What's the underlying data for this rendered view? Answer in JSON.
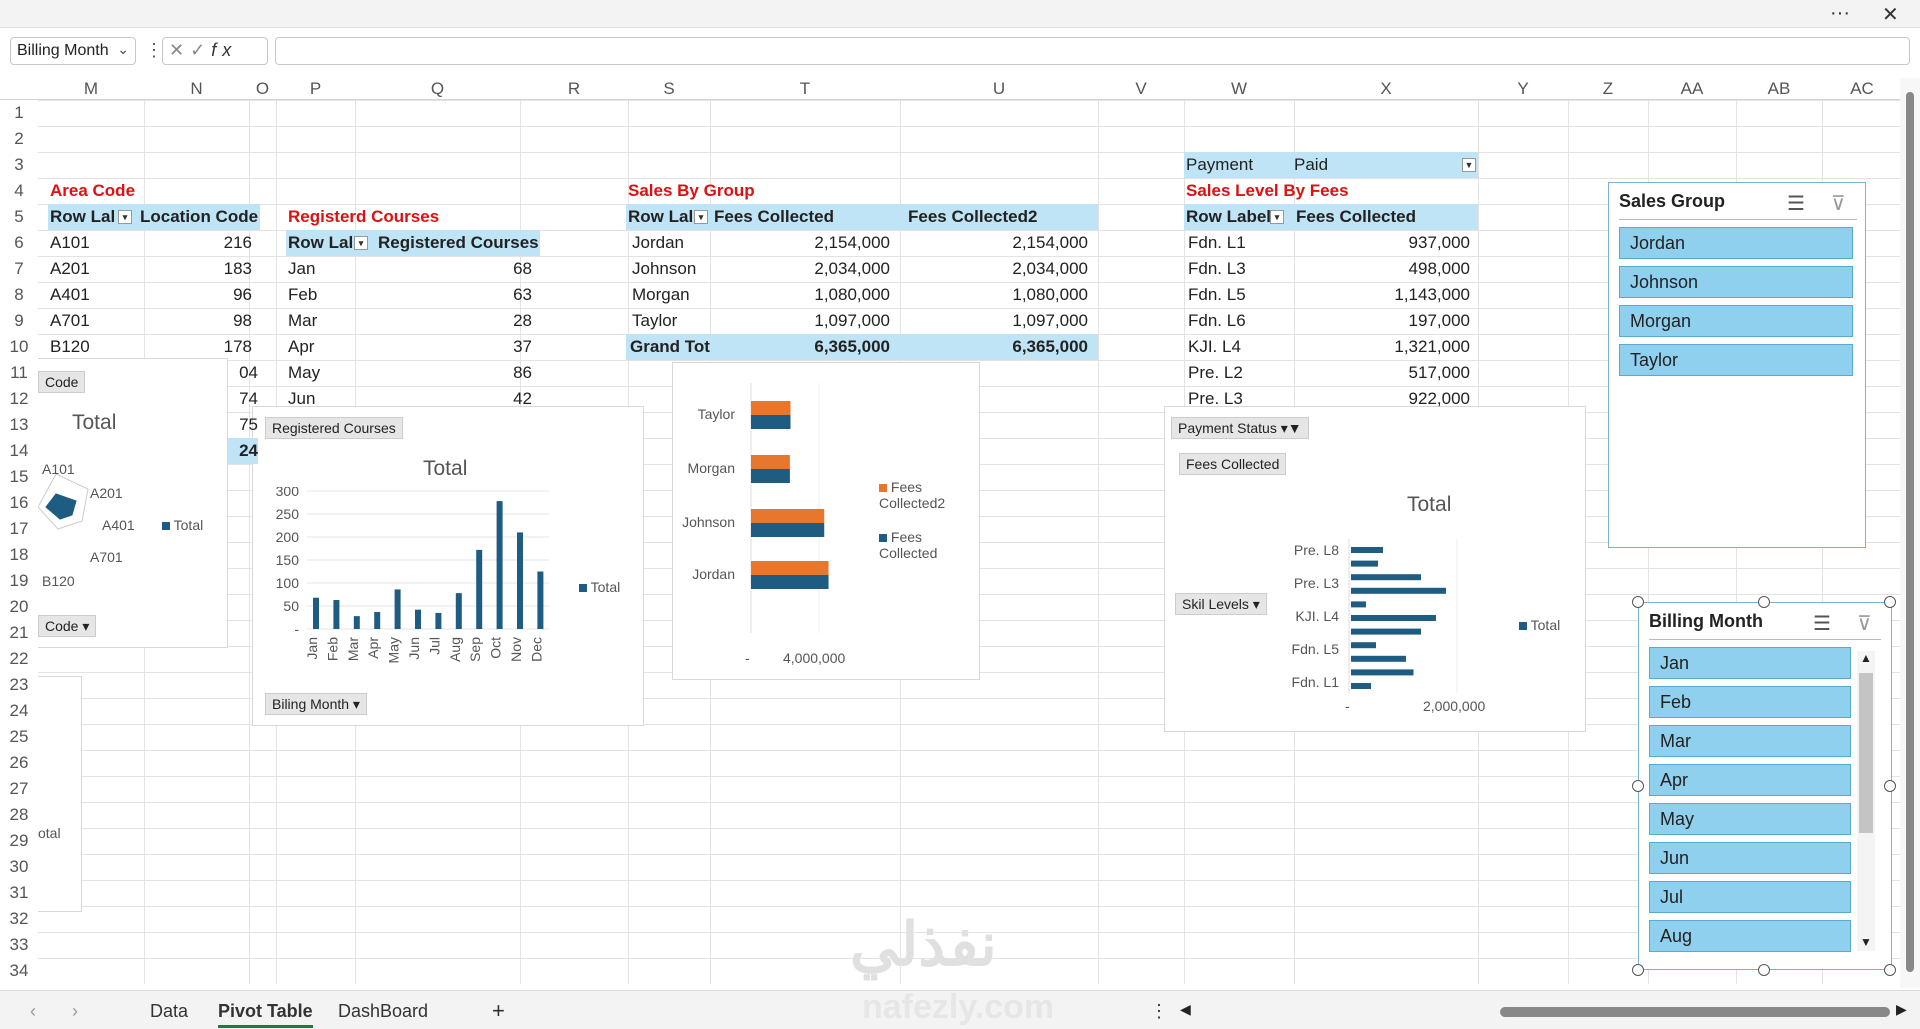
{
  "namebox": {
    "value": "Billing Month",
    "chevron": "⌄"
  },
  "formula_buttons": [
    "✕",
    "✓",
    "fx"
  ],
  "window_icons": {
    "more": "···",
    "close": "✕"
  },
  "columns": [
    "M",
    "N",
    "O",
    "P",
    "Q",
    "R",
    "S",
    "T",
    "U",
    "V",
    "W",
    "X",
    "Y",
    "Z",
    "AA",
    "AB",
    "AC"
  ],
  "rows": [
    "1",
    "2",
    "3",
    "4",
    "5",
    "6",
    "7",
    "8",
    "9",
    "10",
    "11",
    "12",
    "13",
    "14",
    "15",
    "16",
    "17",
    "18",
    "19",
    "20",
    "21",
    "22",
    "23",
    "24",
    "25",
    "26",
    "27",
    "28",
    "29",
    "30",
    "31",
    "32",
    "33",
    "34"
  ],
  "area_pivot": {
    "title": "Area Code",
    "headers": [
      "Row Lal",
      "Location Code"
    ],
    "rows": [
      [
        "A101",
        "216"
      ],
      [
        "A201",
        "183"
      ],
      [
        "A401",
        "96"
      ],
      [
        "A701",
        "98"
      ],
      [
        "B120",
        "178"
      ]
    ],
    "partial_values": [
      "04",
      "74",
      "75",
      "24"
    ]
  },
  "courses_pivot": {
    "title": "Registerd Courses",
    "headers": [
      "Row Lal",
      "Registered Courses"
    ],
    "rows": [
      [
        "Jan",
        "68"
      ],
      [
        "Feb",
        "63"
      ],
      [
        "Mar",
        "28"
      ],
      [
        "Apr",
        "37"
      ],
      [
        "May",
        "86"
      ],
      [
        "Jun",
        "42"
      ]
    ]
  },
  "group_pivot": {
    "title": "Sales By Group",
    "headers": [
      "Row Lal",
      "Fees Collected",
      "Fees Collected2"
    ],
    "rows": [
      [
        "Jordan",
        "2,154,000",
        "2,154,000"
      ],
      [
        "Johnson",
        "2,034,000",
        "2,034,000"
      ],
      [
        "Morgan",
        "1,080,000",
        "1,080,000"
      ],
      [
        "Taylor",
        "1,097,000",
        "1,097,000"
      ]
    ],
    "total": [
      "Grand Tot",
      "6,365,000",
      "6,365,000"
    ]
  },
  "level_pivot": {
    "filter_label": "Payment Sta",
    "filter_value": "Paid",
    "title": "Sales Level By Fees",
    "headers": [
      "Row Label",
      "Fees Collected"
    ],
    "rows": [
      [
        "Fdn. L1",
        "937,000"
      ],
      [
        "Fdn. L3",
        "498,000"
      ],
      [
        "Fdn. L5",
        "1,143,000"
      ],
      [
        "Fdn. L6",
        "197,000"
      ],
      [
        "KJI. L4",
        "1,321,000"
      ],
      [
        "Pre. L2",
        "517,000"
      ],
      [
        "Pre. L3",
        "922,000"
      ]
    ]
  },
  "radar_chart": {
    "field_button_top": "Code",
    "field_button_bottom": "Code",
    "title": "Total",
    "legend": "Total",
    "labels": [
      "A101",
      "A201",
      "A401",
      "A701",
      "B120"
    ]
  },
  "small_chart_stub": {
    "label": "otal"
  },
  "courses_chart": {
    "field_button_top": "Registered Courses",
    "field_button_bottom": "Biling  Month",
    "legend": "Total"
  },
  "group_chart": {
    "legend": [
      "Fees Collected2",
      "Fees Collected"
    ],
    "axis_ticks": [
      "-",
      "4,000,000"
    ]
  },
  "level_chart": {
    "field_button_filter": "Payment Status",
    "field_button_value": "Fees Collected",
    "field_button_axis": "Skil  Levels",
    "title": "Total",
    "legend": "Total",
    "axis_ticks": [
      "-",
      "2,000,000"
    ]
  },
  "chart_data": [
    {
      "type": "radar",
      "title": "Total",
      "categories": [
        "A101",
        "A201",
        "A401",
        "A701",
        "B120"
      ],
      "values": [
        216,
        183,
        96,
        98,
        178
      ],
      "series": [
        {
          "name": "Total",
          "values": [
            216,
            183,
            96,
            98,
            178
          ]
        }
      ]
    },
    {
      "type": "bar",
      "title": "Total",
      "categories": [
        "Jan",
        "Feb",
        "Mar",
        "Apr",
        "May",
        "Jun",
        "Jul",
        "Aug",
        "Sep",
        "Oct",
        "Nov",
        "Dec"
      ],
      "series": [
        {
          "name": "Total",
          "values": [
            68,
            63,
            28,
            37,
            86,
            42,
            35,
            78,
            172,
            278,
            210,
            125
          ]
        }
      ],
      "ylim": [
        0,
        300
      ],
      "yticks": [
        "300",
        "250",
        "200",
        "150",
        "100",
        "50",
        "-"
      ]
    },
    {
      "type": "bar",
      "orientation": "horizontal",
      "categories": [
        "Taylor",
        "Morgan",
        "Johnson",
        "Jordan"
      ],
      "series": [
        {
          "name": "Fees Collected2",
          "values": [
            1097000,
            1080000,
            2034000,
            2154000
          ],
          "color": "#e8772e"
        },
        {
          "name": "Fees Collected",
          "values": [
            1097000,
            1080000,
            2034000,
            2154000
          ],
          "color": "#1f5c82"
        }
      ],
      "xlim": [
        0,
        8000000
      ]
    },
    {
      "type": "bar",
      "orientation": "horizontal",
      "title": "Total",
      "categories": [
        "Pre. L8",
        "Pre. L3",
        "KJI. L4",
        "Fdn. L5",
        "Fdn. L1"
      ],
      "category_labels_shown": [
        "Pre. L8",
        "Pre. L3",
        "KJI. L4",
        "Fdn. L5",
        "Fdn. L1"
      ],
      "series": [
        {
          "name": "Total",
          "values": [
            640000,
            540000,
            1400000,
            1900000,
            300000,
            1700000,
            1400000,
            500000,
            1100000,
            1250000,
            400000
          ]
        }
      ],
      "xlim": [
        0,
        4000000
      ]
    }
  ],
  "slicer_group": {
    "title": "Sales Group",
    "items": [
      "Jordan",
      "Johnson",
      "Morgan",
      "Taylor"
    ]
  },
  "slicer_month": {
    "title": "Billing Month",
    "items": [
      "Jan",
      "Feb",
      "Mar",
      "Apr",
      "May",
      "Jun",
      "Jul",
      "Aug"
    ]
  },
  "sheet_tabs": [
    "Data",
    "Pivot Table",
    "DashBoard"
  ],
  "active_tab": "Pivot Table",
  "add_sheet": "+",
  "watermark": {
    "arabic": "نفذلي",
    "latin": "nafezly.com"
  },
  "colors": {
    "accent": "#1f5c82",
    "orange": "#e8772e",
    "header_bg": "#bfe4f5",
    "slicer_item": "#8fd0ee",
    "title_red": "#dd1111"
  }
}
